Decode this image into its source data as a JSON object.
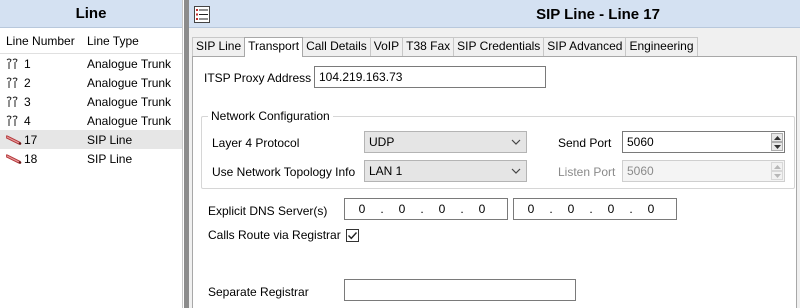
{
  "left_panel": {
    "title": "Line",
    "columns": {
      "number": "Line Number",
      "type": "Line Type"
    },
    "rows": [
      {
        "number": "1",
        "type": "Analogue Trunk",
        "icon": "analogue-trunk-icon",
        "selected": false
      },
      {
        "number": "2",
        "type": "Analogue Trunk",
        "icon": "analogue-trunk-icon",
        "selected": false
      },
      {
        "number": "3",
        "type": "Analogue Trunk",
        "icon": "analogue-trunk-icon",
        "selected": false
      },
      {
        "number": "4",
        "type": "Analogue Trunk",
        "icon": "analogue-trunk-icon",
        "selected": false
      },
      {
        "number": "17",
        "type": "SIP Line",
        "icon": "sip-line-icon",
        "selected": true
      },
      {
        "number": "18",
        "type": "SIP Line",
        "icon": "sip-line-icon",
        "selected": false
      }
    ]
  },
  "right_panel": {
    "title": "SIP Line - Line 17",
    "tabs": [
      {
        "label": "SIP Line",
        "active": false
      },
      {
        "label": "Transport",
        "active": true
      },
      {
        "label": "Call Details",
        "active": false
      },
      {
        "label": "VoIP",
        "active": false
      },
      {
        "label": "T38 Fax",
        "active": false
      },
      {
        "label": "SIP Credentials",
        "active": false
      },
      {
        "label": "SIP Advanced",
        "active": false
      },
      {
        "label": "Engineering",
        "active": false
      }
    ],
    "itsp_proxy": {
      "label": "ITSP Proxy Address",
      "value": "104.219.163.73"
    },
    "network_config": {
      "title": "Network Configuration",
      "layer4": {
        "label": "Layer 4 Protocol",
        "value": "UDP"
      },
      "topology": {
        "label": "Use Network Topology Info",
        "value": "LAN 1"
      },
      "send_port": {
        "label": "Send Port",
        "value": "5060"
      },
      "listen_port": {
        "label": "Listen Port",
        "value": "5060",
        "enabled": false
      }
    },
    "dns": {
      "label": "Explicit DNS Server(s)",
      "server1": [
        "0",
        "0",
        "0",
        "0"
      ],
      "server2": [
        "0",
        "0",
        "0",
        "0"
      ]
    },
    "calls_route": {
      "label": "Calls Route via Registrar",
      "checked": true
    },
    "separate_registrar": {
      "label": "Separate Registrar",
      "value": ""
    }
  },
  "colors": {
    "title_bar": "#d4e1f2",
    "selected_row": "#e6e6e6",
    "splitter": "#8c8c8c",
    "panel_bg": "#f0f0f0",
    "sip_icon": "#b5363a"
  }
}
